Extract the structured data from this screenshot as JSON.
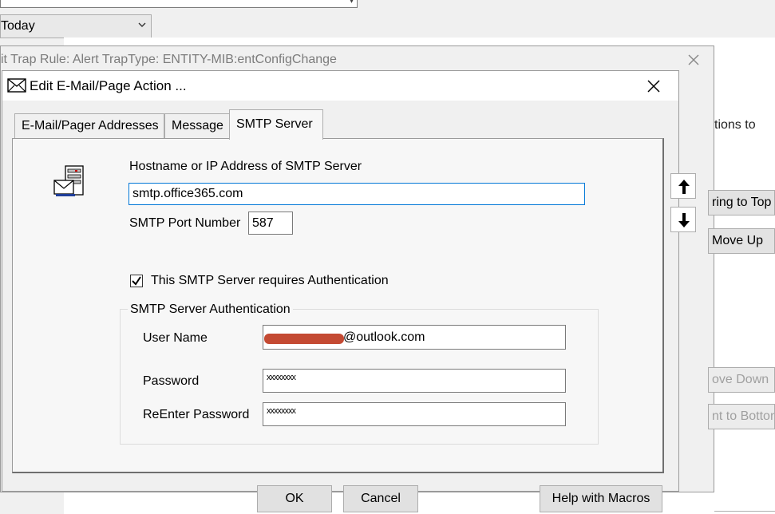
{
  "background": {
    "date_combo_value": "Today",
    "trap_window_title": "it Trap Rule: Alert TrapType: ENTITY-MIB:entConfigChange",
    "right_panel": {
      "desc_text": "tions to",
      "bring_to_top": "ring to Top",
      "move_up": "Move Up",
      "move_down": "ove Down",
      "move_to_bottom": "nt to Botton"
    }
  },
  "dialog": {
    "title": "Edit E-Mail/Page Action ...",
    "tabs": [
      {
        "label": "E-Mail/Pager Addresses"
      },
      {
        "label": "Message"
      },
      {
        "label": "SMTP Server"
      }
    ],
    "active_tab": "SMTP Server",
    "smtp": {
      "hostname_label": "Hostname or IP Address of SMTP Server",
      "hostname_value": "smtp.office365.com",
      "port_label": "SMTP Port Number",
      "port_value": "587",
      "auth_checkbox_label": "This SMTP Server requires Authentication",
      "auth_checked": true,
      "auth_group_label": "SMTP Server Authentication",
      "username_label": "User Name",
      "username_value": "@outlook.com",
      "password_label": "Password",
      "password_value": "xxxxxxxx",
      "reenter_label": "ReEnter Password",
      "reenter_value": "xxxxxxxx"
    },
    "buttons": {
      "ok": "OK",
      "cancel": "Cancel",
      "help_macros": "Help with Macros"
    }
  },
  "colors": {
    "focus_border": "#0078d7",
    "redaction": "#c44a33"
  }
}
